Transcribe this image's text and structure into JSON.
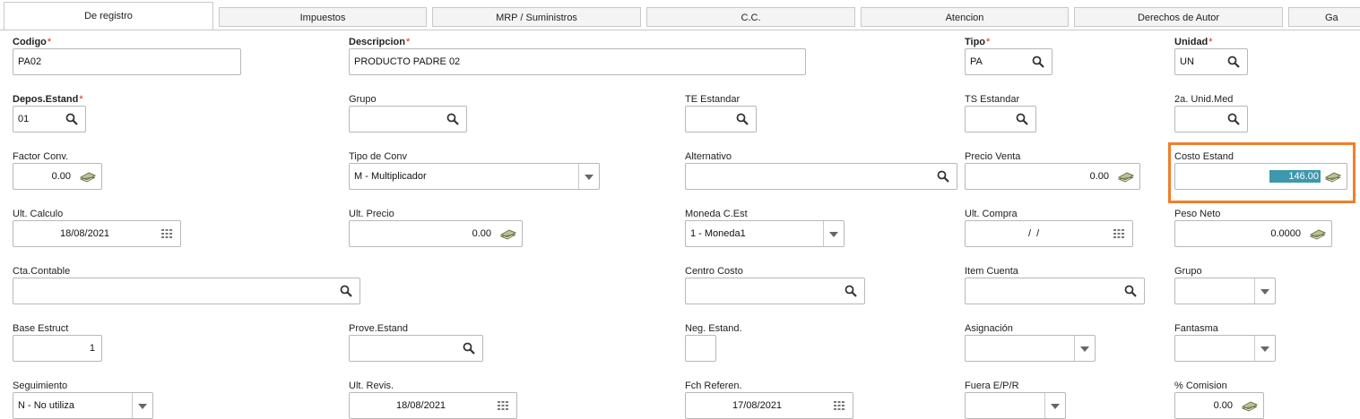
{
  "tabs": [
    "De registro",
    "Impuestos",
    "MRP / Suministros",
    "C.C.",
    "Atencion",
    "Derechos de Autor",
    "Ga"
  ],
  "fields": {
    "codigo": {
      "label": "Codigo",
      "value": "PA02"
    },
    "descripcion": {
      "label": "Descripcion",
      "value": "PRODUCTO PADRE 02"
    },
    "tipo": {
      "label": "Tipo",
      "value": "PA"
    },
    "unidad": {
      "label": "Unidad",
      "value": "UN"
    },
    "depos_estand": {
      "label": "Depos.Estand",
      "value": "01"
    },
    "grupo1": {
      "label": "Grupo",
      "value": ""
    },
    "te_estandar": {
      "label": "TE Estandar",
      "value": ""
    },
    "ts_estandar": {
      "label": "TS Estandar",
      "value": ""
    },
    "unid_med2": {
      "label": "2a. Unid.Med",
      "value": ""
    },
    "factor_conv": {
      "label": "Factor Conv.",
      "value": "0.00"
    },
    "tipo_conv": {
      "label": "Tipo de Conv",
      "value": "M - Multiplicador"
    },
    "alternativo": {
      "label": "Alternativo",
      "value": ""
    },
    "precio_venta": {
      "label": "Precio Venta",
      "value": "0.00"
    },
    "costo_estand": {
      "label": "Costo Estand",
      "value": "146.00"
    },
    "ult_calculo": {
      "label": "Ult. Calculo",
      "value": "18/08/2021"
    },
    "ult_precio": {
      "label": "Ult. Precio",
      "value": "0.00"
    },
    "moneda_cest": {
      "label": "Moneda C.Est",
      "value": "1 - Moneda1"
    },
    "ult_compra": {
      "label": "Ult. Compra",
      "value": "/  /"
    },
    "peso_neto": {
      "label": "Peso Neto",
      "value": "0.0000"
    },
    "cta_contable": {
      "label": "Cta.Contable",
      "value": ""
    },
    "centro_costo": {
      "label": "Centro Costo",
      "value": ""
    },
    "item_cuenta": {
      "label": "Item Cuenta",
      "value": ""
    },
    "grupo2": {
      "label": "Grupo",
      "value": ""
    },
    "base_estruct": {
      "label": "Base Estruct",
      "value": "1"
    },
    "prove_estand": {
      "label": "Prove.Estand",
      "value": ""
    },
    "neg_estand": {
      "label": "Neg. Estand.",
      "value": ""
    },
    "asignacion": {
      "label": "Asignación",
      "value": ""
    },
    "fantasma": {
      "label": "Fantasma",
      "value": ""
    },
    "seguimiento": {
      "label": "Seguimiento",
      "value": "N - No utiliza"
    },
    "ult_revis": {
      "label": "Ult. Revis.",
      "value": "18/08/2021"
    },
    "fch_referen": {
      "label": "Fch Referen.",
      "value": "17/08/2021"
    },
    "fuera_epr": {
      "label": "Fuera E/P/R",
      "value": ""
    },
    "comision": {
      "label": "% Comision",
      "value": "0.00"
    }
  },
  "required_marker": "*",
  "colors": {
    "highlight": "#f07f2a",
    "selection": "#3d98ad",
    "required": "#d22222"
  },
  "icons": {
    "lookup": "search-icon",
    "money": "money-icon",
    "calendar": "calendar-icon",
    "dropdown": "chevron-down-icon"
  }
}
